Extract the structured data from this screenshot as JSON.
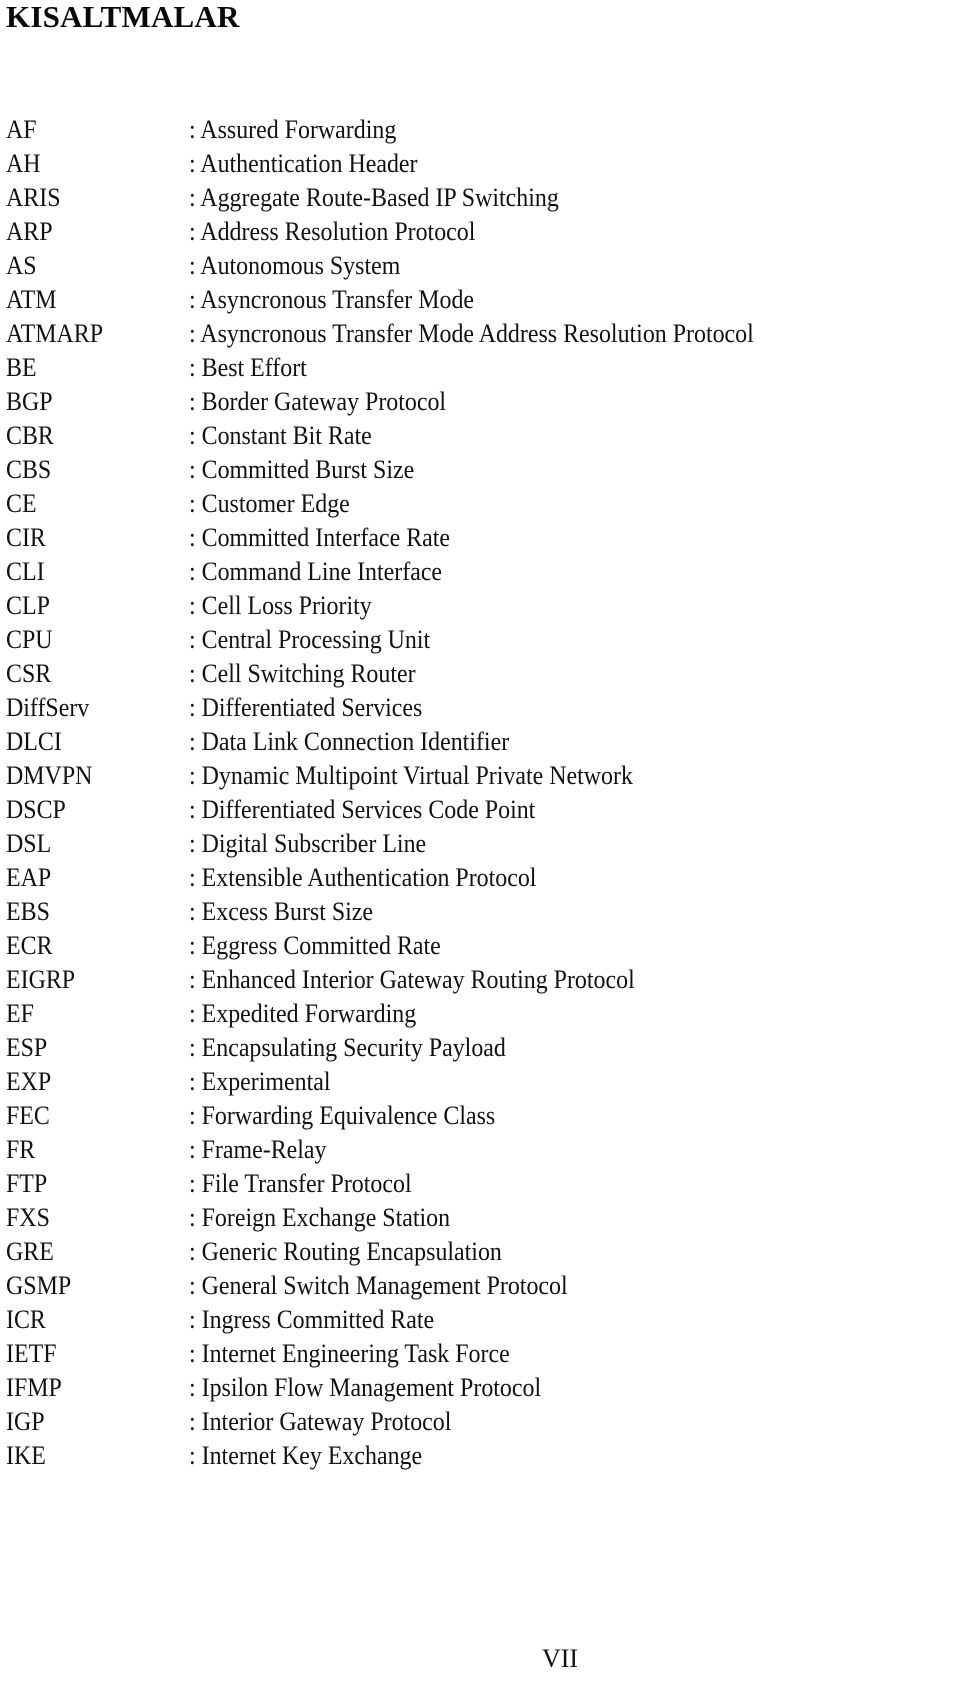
{
  "document": {
    "title": "KISALTMALAR",
    "page_number": "VII",
    "separator": ": ",
    "abbreviations": [
      {
        "term": "AF",
        "definition": "Assured Forwarding"
      },
      {
        "term": "AH",
        "definition": "Authentication Header"
      },
      {
        "term": "ARIS",
        "definition": "Aggregate Route-Based IP Switching"
      },
      {
        "term": "ARP",
        "definition": "Address Resolution Protocol"
      },
      {
        "term": "AS",
        "definition": "Autonomous System"
      },
      {
        "term": "ATM",
        "definition": "Asyncronous Transfer Mode"
      },
      {
        "term": "ATMARP",
        "definition": "Asyncronous Transfer Mode Address Resolution Protocol"
      },
      {
        "term": "BE",
        "definition": "Best Effort"
      },
      {
        "term": "BGP",
        "definition": "Border Gateway Protocol"
      },
      {
        "term": "CBR",
        "definition": "Constant Bit Rate"
      },
      {
        "term": "CBS",
        "definition": "Committed Burst Size"
      },
      {
        "term": "CE",
        "definition": "Customer Edge"
      },
      {
        "term": "CIR",
        "definition": "Committed Interface Rate"
      },
      {
        "term": "CLI",
        "definition": "Command Line Interface"
      },
      {
        "term": "CLP",
        "definition": "Cell Loss Priority"
      },
      {
        "term": "CPU",
        "definition": "Central Processing Unit"
      },
      {
        "term": "CSR",
        "definition": "Cell Switching Router"
      },
      {
        "term": "DiffServ",
        "definition": "Differentiated Services"
      },
      {
        "term": "DLCI",
        "definition": "Data Link Connection Identifier"
      },
      {
        "term": "DMVPN",
        "definition": "Dynamic Multipoint Virtual Private Network"
      },
      {
        "term": "DSCP",
        "definition": "Differentiated Services Code Point"
      },
      {
        "term": "DSL",
        "definition": "Digital Subscriber Line"
      },
      {
        "term": "EAP",
        "definition": "Extensible Authentication Protocol"
      },
      {
        "term": "EBS",
        "definition": "Excess Burst Size"
      },
      {
        "term": "ECR",
        "definition": "Eggress Committed Rate"
      },
      {
        "term": "EIGRP",
        "definition": "Enhanced Interior Gateway Routing Protocol"
      },
      {
        "term": "EF",
        "definition": "Expedited Forwarding"
      },
      {
        "term": "ESP",
        "definition": "Encapsulating Security Payload"
      },
      {
        "term": "EXP",
        "definition": "Experimental"
      },
      {
        "term": "FEC",
        "definition": "Forwarding Equivalence Class"
      },
      {
        "term": "FR",
        "definition": "Frame-Relay"
      },
      {
        "term": "FTP",
        "definition": "File Transfer Protocol"
      },
      {
        "term": "FXS",
        "definition": "Foreign Exchange Station"
      },
      {
        "term": "GRE",
        "definition": "Generic Routing Encapsulation"
      },
      {
        "term": "GSMP",
        "definition": "General Switch Management Protocol"
      },
      {
        "term": "ICR",
        "definition": "Ingress Committed Rate"
      },
      {
        "term": "IETF",
        "definition": "Internet Engineering Task Force"
      },
      {
        "term": "IFMP",
        "definition": "Ipsilon Flow Management Protocol"
      },
      {
        "term": "IGP",
        "definition": "Interior Gateway Protocol"
      },
      {
        "term": "IKE",
        "definition": "Internet Key Exchange"
      }
    ]
  }
}
